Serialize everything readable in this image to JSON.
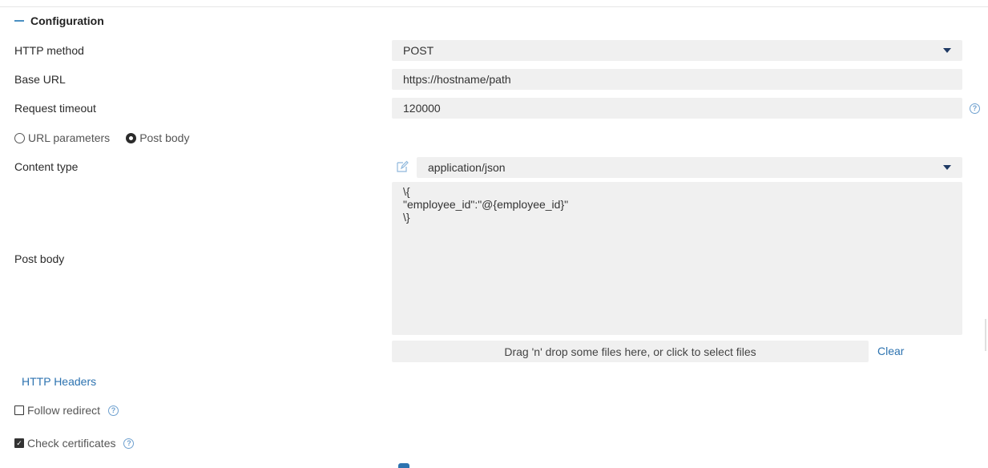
{
  "section": {
    "title": "Configuration",
    "collapse_icon": "minus-icon"
  },
  "http_method": {
    "label": "HTTP method",
    "value": "POST"
  },
  "base_url": {
    "label": "Base URL",
    "value": "https://hostname/path"
  },
  "request_timeout": {
    "label": "Request timeout",
    "value": "120000",
    "help_icon": "?"
  },
  "param_mode": {
    "options": [
      {
        "label": "URL parameters",
        "checked": false
      },
      {
        "label": "Post body",
        "checked": true
      }
    ]
  },
  "content_type": {
    "label": "Content type",
    "value": "application/json",
    "edit_icon": "pencil-icon"
  },
  "post_body": {
    "label": "Post body",
    "value": "\\{\n\"employee_id\":\"@{employee_id}\"\n\\}"
  },
  "dropzone": {
    "text": "Drag 'n' drop some files here, or click to select files",
    "clear_label": "Clear"
  },
  "http_headers": {
    "label": "HTTP Headers"
  },
  "follow_redirect": {
    "label": "Follow redirect",
    "checked": false,
    "help_icon": "?"
  },
  "check_certificates": {
    "label": "Check certificates",
    "checked": true,
    "help_icon": "?"
  },
  "colors": {
    "accent": "#2d73b0",
    "field_bg": "#f0f0f0",
    "caret": "#1f3a64"
  }
}
